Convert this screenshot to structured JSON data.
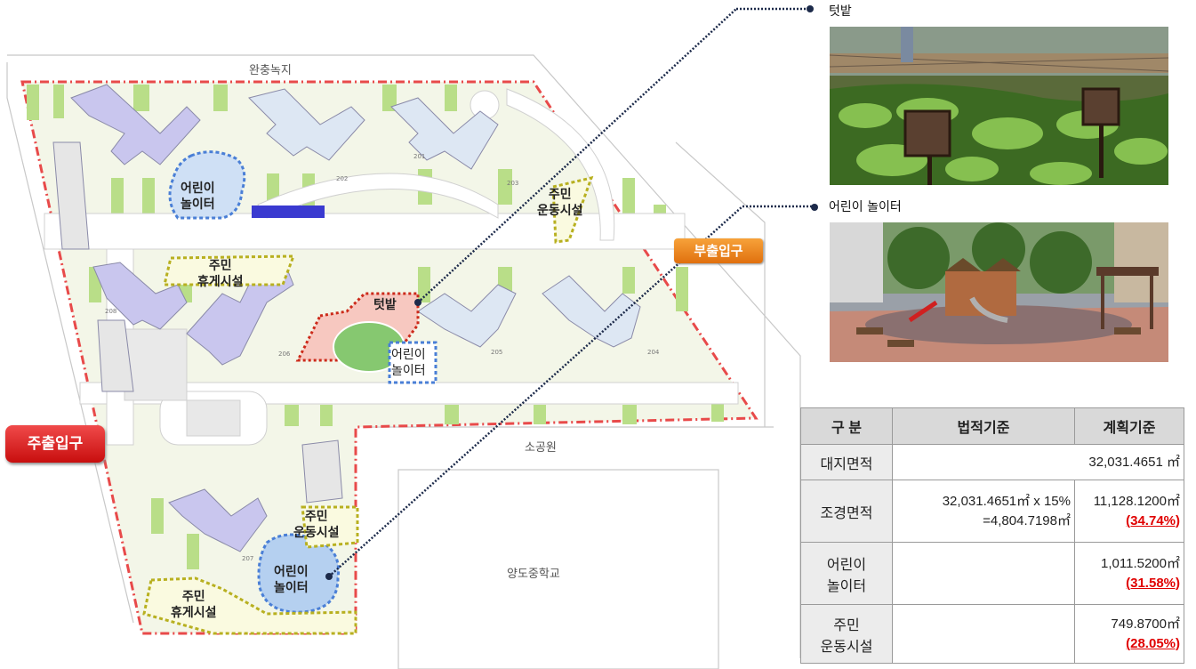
{
  "site_labels": {
    "buffer_green": "완충녹지",
    "small_park": "소공원",
    "school": "양도중학교"
  },
  "entrances": {
    "main": "주출입구",
    "sub": "부출입구"
  },
  "zones": {
    "playground_1": "어린이\n놀이터",
    "playground_2": "어린이\n놀이터",
    "playground_3": "어린이\n놀이터",
    "rest_1": "주민\n휴게시설",
    "rest_2": "주민\n휴게시설",
    "exercise_1": "주민\n운동시설",
    "exercise_2": "주민\n운동시설",
    "garden": "텃밭"
  },
  "building_numbers": [
    "201",
    "202",
    "203",
    "204",
    "205",
    "206",
    "207",
    "208"
  ],
  "photos": {
    "garden_caption": "텃밭",
    "playground_caption": "어린이 놀이터"
  },
  "colors": {
    "boundary": "#e84a4a",
    "building": "#c9c6ee",
    "building_alt": "#dde7f3",
    "lawn": "#e8f3c6",
    "green": "#b9de88",
    "playground_line": "#4a7fd6",
    "rest_line": "#b8b020",
    "garden_line": "#cc2a1a",
    "leader": "#1c2a4a"
  },
  "table": {
    "headers": [
      "구 분",
      "법적기준",
      "계획기준"
    ],
    "rows": [
      {
        "label": "대지면적",
        "legal": "",
        "plan": "32,031.4651 ㎡",
        "pct": ""
      },
      {
        "label": "조경면적",
        "legal": "32,031.4651㎡ x 15%\n=4,804.7198㎡",
        "plan": "11,128.1200㎡",
        "pct": "(34.74%)"
      },
      {
        "label": "어린이\n놀이터",
        "legal": "",
        "plan": "1,011.5200㎡",
        "pct": "(31.58%)"
      },
      {
        "label": "주민\n운동시설",
        "legal": "",
        "plan": "749.8700㎡",
        "pct": "(28.05%)"
      }
    ]
  }
}
